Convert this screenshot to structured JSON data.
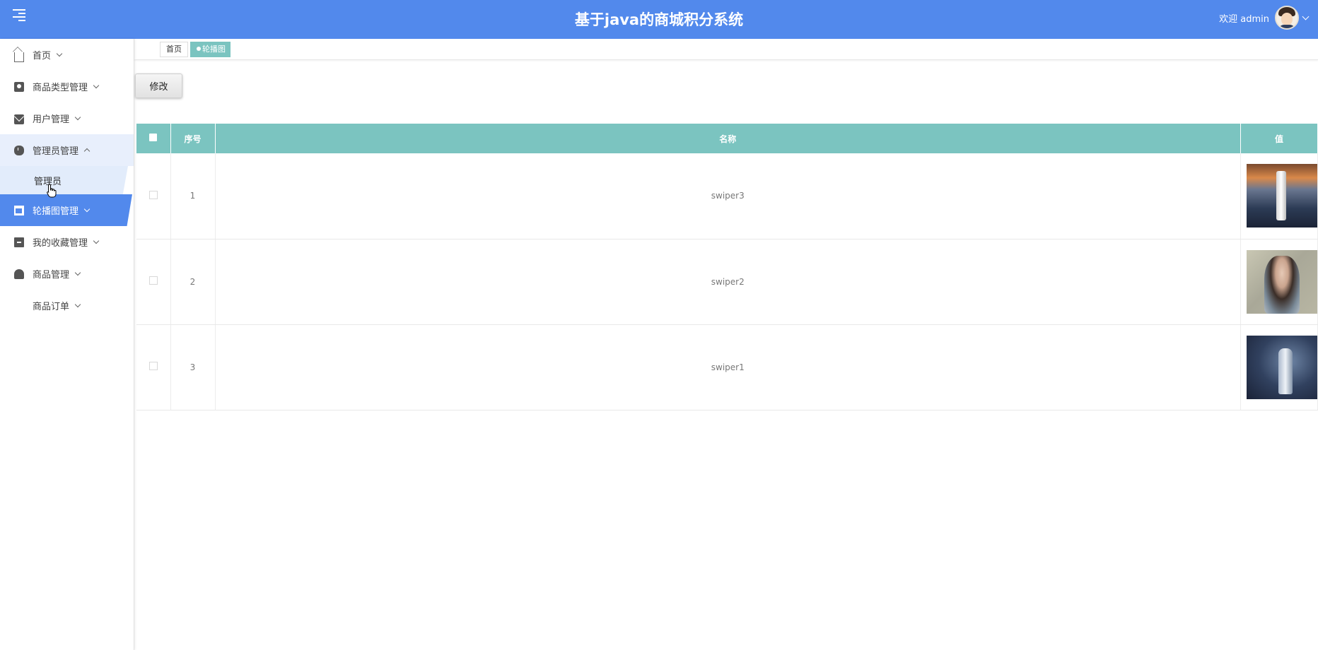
{
  "header": {
    "title": "基于java的商城积分系统",
    "welcome_text": "欢迎 admin",
    "bg_color": "#5289ec"
  },
  "sidebar": {
    "items": [
      {
        "label": "首页",
        "icon": "home-icon"
      },
      {
        "label": "商品类型管理",
        "icon": "book-icon"
      },
      {
        "label": "用户管理",
        "icon": "mail-icon"
      },
      {
        "label": "管理员管理",
        "icon": "mouse-icon",
        "expanded": true,
        "children": [
          {
            "label": "管理员"
          }
        ]
      },
      {
        "label": "轮播图管理",
        "icon": "window-icon",
        "active": true
      },
      {
        "label": "我的收藏管理",
        "icon": "archive-icon"
      },
      {
        "label": "商品管理",
        "icon": "spy-icon"
      },
      {
        "label": "商品订单",
        "icon": ""
      }
    ]
  },
  "tabs": [
    {
      "label": "首页"
    },
    {
      "label": "轮播图",
      "active": true,
      "close": "×"
    }
  ],
  "toolbar": {
    "edit_label": "修改"
  },
  "table": {
    "headers": [
      "序号",
      "名称",
      "值"
    ],
    "header_color": "#7bc4c0",
    "rows": [
      {
        "index": "1",
        "name": "swiper3",
        "image": "swiper3-image"
      },
      {
        "index": "2",
        "name": "swiper2",
        "image": "swiper2-image"
      },
      {
        "index": "3",
        "name": "swiper1",
        "image": "swiper1-image"
      }
    ]
  }
}
